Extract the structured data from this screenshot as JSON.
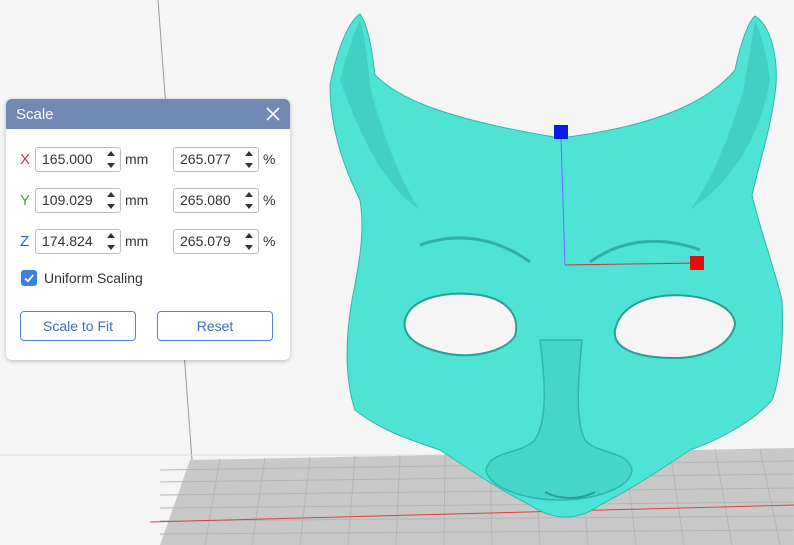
{
  "panel": {
    "title": "Scale",
    "rows": [
      {
        "axis": "X",
        "axis_color": "#d43a3a",
        "size": "165.000",
        "size_unit": "mm",
        "percent": "265.077",
        "percent_unit": "%"
      },
      {
        "axis": "Y",
        "axis_color": "#3da83d",
        "size": "109.029",
        "size_unit": "mm",
        "percent": "265.080",
        "percent_unit": "%"
      },
      {
        "axis": "Z",
        "axis_color": "#2c5fd0",
        "size": "174.824",
        "size_unit": "mm",
        "percent": "265.079",
        "percent_unit": "%"
      }
    ],
    "uniform_scaling": {
      "label": "Uniform Scaling",
      "checked": true
    },
    "scale_to_fit_label": "Scale to Fit",
    "reset_label": "Reset"
  },
  "colors": {
    "header": "#7189b3",
    "accent": "#3f7fe0",
    "model": "#4fe3d6",
    "gizmo_x": "#e01010",
    "gizmo_z": "#0a1de0"
  }
}
